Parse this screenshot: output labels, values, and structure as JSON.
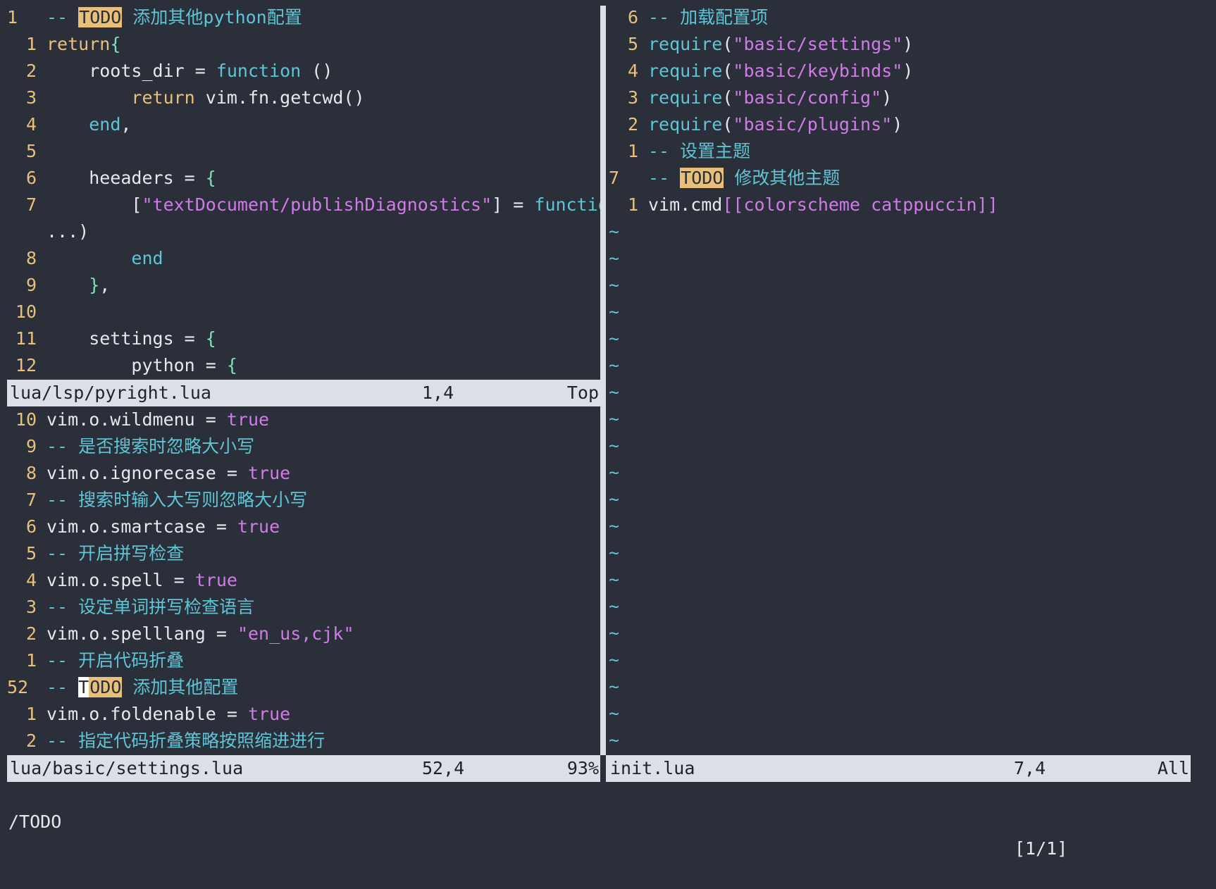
{
  "top_left": {
    "lines": [
      {
        "ln": "1",
        "cur": true,
        "segs": [
          [
            "comment",
            "-- "
          ],
          [
            "todo",
            "TODO"
          ],
          [
            "comment",
            " 添加其他python配置"
          ]
        ]
      },
      {
        "ln": "1",
        "segs": [
          [
            "kw",
            "return"
          ],
          [
            "brace",
            "{"
          ]
        ]
      },
      {
        "ln": "2",
        "segs": [
          [
            "plain",
            "    roots_dir = "
          ],
          [
            "fn",
            "function"
          ],
          [
            "plain",
            " ()"
          ]
        ]
      },
      {
        "ln": "3",
        "segs": [
          [
            "plain",
            "        "
          ],
          [
            "kw",
            "return"
          ],
          [
            "plain",
            " vim.fn.getcwd()"
          ]
        ]
      },
      {
        "ln": "4",
        "segs": [
          [
            "plain",
            "    "
          ],
          [
            "fn",
            "end"
          ],
          [
            "plain",
            ","
          ]
        ]
      },
      {
        "ln": "5",
        "segs": []
      },
      {
        "ln": "6",
        "segs": [
          [
            "plain",
            "    heeaders = "
          ],
          [
            "brace",
            "{"
          ]
        ]
      },
      {
        "ln": "7",
        "segs": [
          [
            "plain",
            "        ["
          ],
          [
            "str",
            "\"textDocument/publishDiagnostics\""
          ],
          [
            "plain",
            "] = "
          ],
          [
            "fn",
            "function"
          ],
          [
            "plain",
            " ("
          ]
        ]
      },
      {
        "ln": "",
        "segs": [
          [
            "plain",
            "...)"
          ]
        ]
      },
      {
        "ln": "8",
        "segs": [
          [
            "plain",
            "        "
          ],
          [
            "fn",
            "end"
          ]
        ]
      },
      {
        "ln": "9",
        "segs": [
          [
            "plain",
            "    "
          ],
          [
            "brace",
            "}"
          ],
          [
            "plain",
            ","
          ]
        ]
      },
      {
        "ln": "10",
        "segs": []
      },
      {
        "ln": "11",
        "segs": [
          [
            "plain",
            "    settings = "
          ],
          [
            "brace",
            "{"
          ]
        ]
      },
      {
        "ln": "12",
        "segs": [
          [
            "plain",
            "        python = "
          ],
          [
            "brace",
            "{"
          ]
        ]
      }
    ],
    "status": {
      "file": "lua/lsp/pyright.lua",
      "pos": "1,4",
      "pct": "Top"
    }
  },
  "bottom_left": {
    "lines": [
      {
        "ln": "10",
        "segs": [
          [
            "plain",
            "vim.o.wildmenu = "
          ],
          [
            "bool",
            "true"
          ]
        ]
      },
      {
        "ln": "9",
        "segs": [
          [
            "comment",
            "-- 是否搜索时忽略大小写"
          ]
        ]
      },
      {
        "ln": "8",
        "segs": [
          [
            "plain",
            "vim.o.ignorecase = "
          ],
          [
            "bool",
            "true"
          ]
        ]
      },
      {
        "ln": "7",
        "segs": [
          [
            "comment",
            "-- 搜索时输入大写则忽略大小写"
          ]
        ]
      },
      {
        "ln": "6",
        "segs": [
          [
            "plain",
            "vim.o.smartcase = "
          ],
          [
            "bool",
            "true"
          ]
        ]
      },
      {
        "ln": "5",
        "segs": [
          [
            "comment",
            "-- 开启拼写检查"
          ]
        ]
      },
      {
        "ln": "4",
        "segs": [
          [
            "plain",
            "vim.o.spell = "
          ],
          [
            "bool",
            "true"
          ]
        ]
      },
      {
        "ln": "3",
        "segs": [
          [
            "comment",
            "-- 设定单词拼写检查语言"
          ]
        ]
      },
      {
        "ln": "2",
        "segs": [
          [
            "plain",
            "vim.o.spelllang = "
          ],
          [
            "str",
            "\"en_us,cjk\""
          ]
        ]
      },
      {
        "ln": "1",
        "segs": [
          [
            "comment",
            "-- 开启代码折叠"
          ]
        ]
      },
      {
        "ln": "52",
        "cur": true,
        "segs": [
          [
            "comment",
            "-- "
          ],
          [
            "cursor",
            "T"
          ],
          [
            "todo",
            "ODO"
          ],
          [
            "comment",
            " 添加其他配置"
          ]
        ]
      },
      {
        "ln": "1",
        "segs": [
          [
            "plain",
            "vim.o.foldenable = "
          ],
          [
            "bool",
            "true"
          ]
        ]
      },
      {
        "ln": "2",
        "segs": [
          [
            "comment",
            "-- 指定代码折叠策略按照缩进进行"
          ]
        ]
      }
    ],
    "status": {
      "file": "lua/basic/settings.lua",
      "pos": "52,4",
      "pct": "93%"
    }
  },
  "right": {
    "lines": [
      {
        "ln": "6",
        "segs": [
          [
            "comment",
            "-- 加载配置项"
          ]
        ]
      },
      {
        "ln": "5",
        "segs": [
          [
            "fn",
            "require"
          ],
          [
            "plain",
            "("
          ],
          [
            "str",
            "\"basic/settings\""
          ],
          [
            "plain",
            ")"
          ]
        ]
      },
      {
        "ln": "4",
        "segs": [
          [
            "fn",
            "require"
          ],
          [
            "plain",
            "("
          ],
          [
            "str",
            "\"basic/keybinds\""
          ],
          [
            "plain",
            ")"
          ]
        ]
      },
      {
        "ln": "3",
        "segs": [
          [
            "fn",
            "require"
          ],
          [
            "plain",
            "("
          ],
          [
            "str",
            "\"basic/config\""
          ],
          [
            "plain",
            ")"
          ]
        ]
      },
      {
        "ln": "2",
        "segs": [
          [
            "fn",
            "require"
          ],
          [
            "plain",
            "("
          ],
          [
            "str",
            "\"basic/plugins\""
          ],
          [
            "plain",
            ")"
          ]
        ]
      },
      {
        "ln": "1",
        "segs": [
          [
            "comment",
            "-- 设置主题"
          ]
        ]
      },
      {
        "ln": "7",
        "cur": true,
        "segs": [
          [
            "comment",
            "-- "
          ],
          [
            "todo",
            "TODO"
          ],
          [
            "comment",
            " 修改其他主题"
          ]
        ]
      },
      {
        "ln": "1",
        "segs": [
          [
            "plain",
            "vim.cmd"
          ],
          [
            "str",
            "[[colorscheme catppuccin]]"
          ]
        ]
      }
    ],
    "tilde": "~",
    "status": {
      "file": "init.lua",
      "pos": "7,4",
      "pct": "All"
    }
  },
  "cmdline": {
    "text": "/TODO",
    "count": "[1/1]"
  }
}
